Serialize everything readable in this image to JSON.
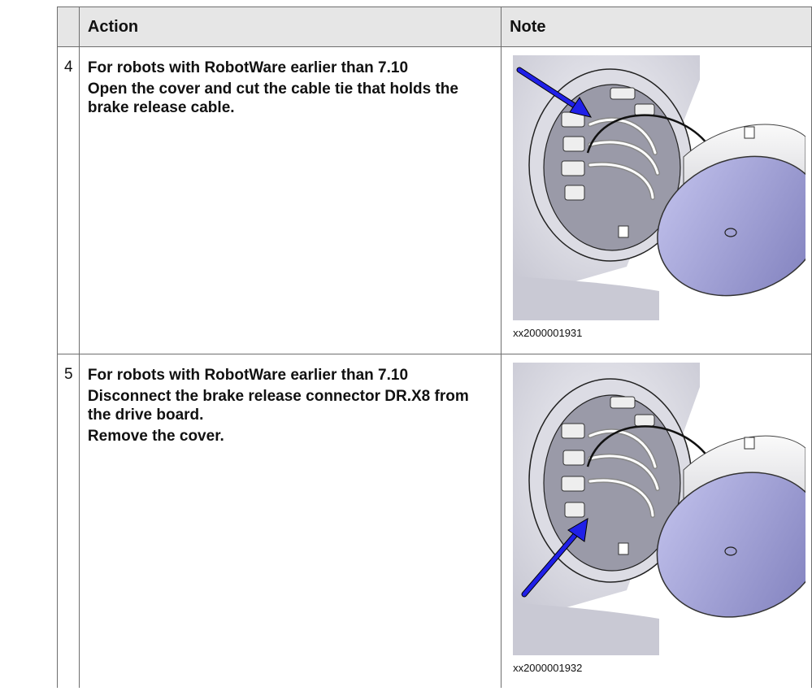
{
  "table": {
    "headers": {
      "step": "",
      "action": "Action",
      "note": "Note"
    },
    "rows": [
      {
        "step": "4",
        "condition": "For robots with RobotWare earlier than 7.10",
        "instructions": [
          "Open the cover and cut the cable tie that holds the brake release cable."
        ],
        "figure_caption": "xx2000001931",
        "figure_icon": "robot-axis-cover-illustration",
        "arrow_color": "#1a1ae6"
      },
      {
        "step": "5",
        "condition": "For robots with RobotWare earlier than 7.10",
        "instructions": [
          "Disconnect the brake release connector DR.X8 from the drive board.",
          "Remove the cover."
        ],
        "figure_caption": "xx2000001932",
        "figure_icon": "robot-axis-cover-illustration",
        "arrow_color": "#1a1ae6"
      }
    ]
  }
}
